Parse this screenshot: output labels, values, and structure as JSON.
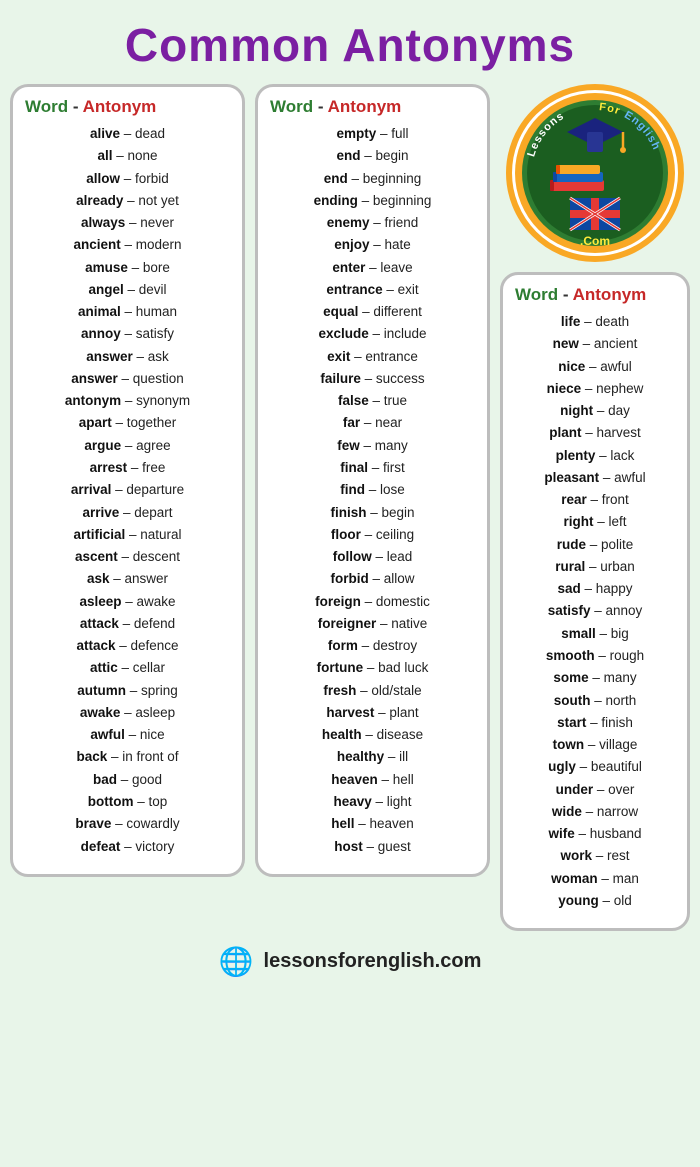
{
  "title": "Common Antonyms",
  "col1_header": {
    "word": "Word",
    "dash": " - ",
    "antonym": "Antonym"
  },
  "col2_header": {
    "word": "Word",
    "dash": " - ",
    "antonym": "Antonym"
  },
  "col3_header": {
    "word": "Word",
    "dash": " - ",
    "antonym": "Antonym"
  },
  "column1": [
    {
      "word": "alive",
      "antonym": "dead"
    },
    {
      "word": "all",
      "antonym": "none"
    },
    {
      "word": "allow",
      "antonym": "forbid"
    },
    {
      "word": "already",
      "antonym": "not yet"
    },
    {
      "word": "always",
      "antonym": "never"
    },
    {
      "word": "ancient",
      "antonym": "modern"
    },
    {
      "word": "amuse",
      "antonym": "bore"
    },
    {
      "word": "angel",
      "antonym": "devil"
    },
    {
      "word": "animal",
      "antonym": "human"
    },
    {
      "word": "annoy",
      "antonym": "satisfy"
    },
    {
      "word": "answer",
      "antonym": "ask"
    },
    {
      "word": "answer",
      "antonym": "question"
    },
    {
      "word": "antonym",
      "antonym": "synonym"
    },
    {
      "word": "apart",
      "antonym": "together"
    },
    {
      "word": "argue",
      "antonym": "agree"
    },
    {
      "word": "arrest",
      "antonym": "free"
    },
    {
      "word": "arrival",
      "antonym": "departure"
    },
    {
      "word": "arrive",
      "antonym": "depart"
    },
    {
      "word": "artificial",
      "antonym": "natural"
    },
    {
      "word": "ascent",
      "antonym": "descent"
    },
    {
      "word": "ask",
      "antonym": "answer"
    },
    {
      "word": "asleep",
      "antonym": "awake"
    },
    {
      "word": "attack",
      "antonym": "defend"
    },
    {
      "word": "attack",
      "antonym": "defence"
    },
    {
      "word": "attic",
      "antonym": "cellar"
    },
    {
      "word": "autumn",
      "antonym": "spring"
    },
    {
      "word": "awake",
      "antonym": "asleep"
    },
    {
      "word": "awful",
      "antonym": "nice"
    },
    {
      "word": "back",
      "antonym": "in front of"
    },
    {
      "word": "bad",
      "antonym": "good"
    },
    {
      "word": "bottom",
      "antonym": "top"
    },
    {
      "word": "brave",
      "antonym": "cowardly"
    },
    {
      "word": "defeat",
      "antonym": "victory"
    }
  ],
  "column2": [
    {
      "word": "empty",
      "antonym": "full"
    },
    {
      "word": "end",
      "antonym": "begin"
    },
    {
      "word": "end",
      "antonym": "beginning"
    },
    {
      "word": "ending",
      "antonym": "beginning"
    },
    {
      "word": "enemy",
      "antonym": "friend"
    },
    {
      "word": "enjoy",
      "antonym": "hate"
    },
    {
      "word": "enter",
      "antonym": "leave"
    },
    {
      "word": "entrance",
      "antonym": "exit"
    },
    {
      "word": "equal",
      "antonym": "different"
    },
    {
      "word": "exclude",
      "antonym": "include"
    },
    {
      "word": "exit",
      "antonym": "entrance"
    },
    {
      "word": "failure",
      "antonym": "success"
    },
    {
      "word": "false",
      "antonym": "true"
    },
    {
      "word": "far",
      "antonym": "near"
    },
    {
      "word": "few",
      "antonym": "many"
    },
    {
      "word": "final",
      "antonym": "first"
    },
    {
      "word": "find",
      "antonym": "lose"
    },
    {
      "word": "finish",
      "antonym": "begin"
    },
    {
      "word": "floor",
      "antonym": "ceiling"
    },
    {
      "word": "follow",
      "antonym": "lead"
    },
    {
      "word": "forbid",
      "antonym": "allow"
    },
    {
      "word": "foreign",
      "antonym": "domestic"
    },
    {
      "word": "foreigner",
      "antonym": "native"
    },
    {
      "word": "form",
      "antonym": "destroy"
    },
    {
      "word": "fortune",
      "antonym": "bad luck"
    },
    {
      "word": "fresh",
      "antonym": "old/stale"
    },
    {
      "word": "harvest",
      "antonym": "plant"
    },
    {
      "word": "health",
      "antonym": "disease"
    },
    {
      "word": "healthy",
      "antonym": "ill"
    },
    {
      "word": "heaven",
      "antonym": "hell"
    },
    {
      "word": "heavy",
      "antonym": "light"
    },
    {
      "word": "hell",
      "antonym": "heaven"
    },
    {
      "word": "host",
      "antonym": "guest"
    }
  ],
  "column3": [
    {
      "word": "life",
      "antonym": "death"
    },
    {
      "word": "new",
      "antonym": "ancient"
    },
    {
      "word": "nice",
      "antonym": "awful"
    },
    {
      "word": "niece",
      "antonym": "nephew"
    },
    {
      "word": "night",
      "antonym": "day"
    },
    {
      "word": "plant",
      "antonym": "harvest"
    },
    {
      "word": "plenty",
      "antonym": "lack"
    },
    {
      "word": "pleasant",
      "antonym": "awful"
    },
    {
      "word": "rear",
      "antonym": "front"
    },
    {
      "word": "right",
      "antonym": "left"
    },
    {
      "word": "rude",
      "antonym": "polite"
    },
    {
      "word": "rural",
      "antonym": "urban"
    },
    {
      "word": "sad",
      "antonym": "happy"
    },
    {
      "word": "satisfy",
      "antonym": "annoy"
    },
    {
      "word": "small",
      "antonym": "big"
    },
    {
      "word": "smooth",
      "antonym": "rough"
    },
    {
      "word": "some",
      "antonym": "many"
    },
    {
      "word": "south",
      "antonym": "north"
    },
    {
      "word": "start",
      "antonym": "finish"
    },
    {
      "word": "town",
      "antonym": "village"
    },
    {
      "word": "ugly",
      "antonym": "beautiful"
    },
    {
      "word": "under",
      "antonym": "over"
    },
    {
      "word": "wide",
      "antonym": "narrow"
    },
    {
      "word": "wife",
      "antonym": "husband"
    },
    {
      "word": "work",
      "antonym": "rest"
    },
    {
      "word": "woman",
      "antonym": "man"
    },
    {
      "word": "young",
      "antonym": "old"
    }
  ],
  "logo": {
    "line1": "Lessons",
    "line2": "For",
    "line3": "English",
    "line4": ".Com"
  },
  "footer": {
    "url": "lessonsforenglish.com"
  }
}
